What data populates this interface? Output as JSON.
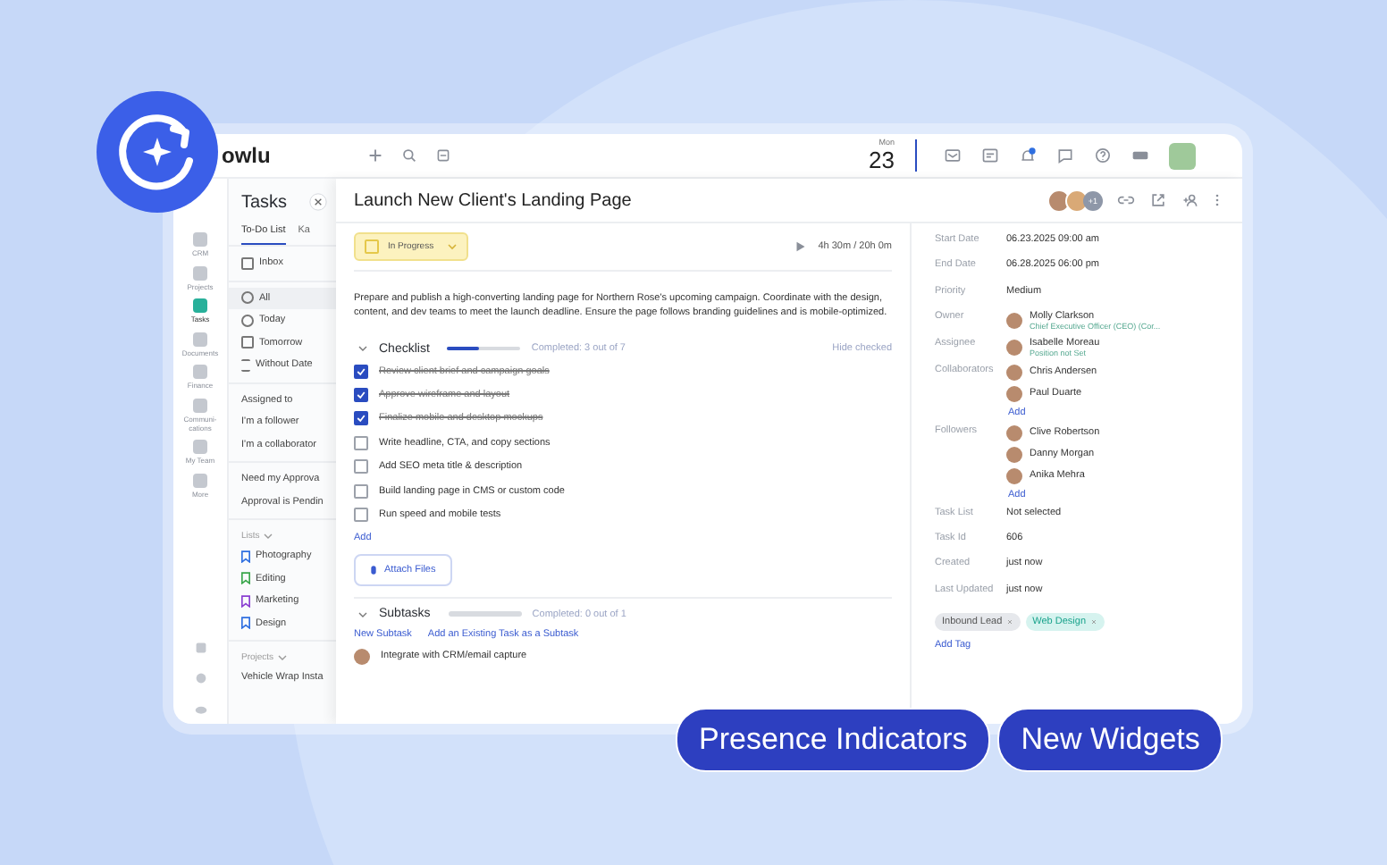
{
  "brand": {
    "text": "owlu"
  },
  "top_bar": {
    "day_name": "Mon",
    "day_number": "23"
  },
  "rail": [
    {
      "label": "CRM",
      "selected": false
    },
    {
      "label": "Projects",
      "selected": false
    },
    {
      "label": "Tasks",
      "selected": true
    },
    {
      "label": "Documents",
      "selected": false
    },
    {
      "label": "Finance",
      "selected": false
    },
    {
      "label": "Communi-cations",
      "selected": false
    },
    {
      "label": "My Team",
      "selected": false
    },
    {
      "label": "More",
      "selected": false
    }
  ],
  "tasks_panel": {
    "title": "Tasks",
    "tabs": [
      {
        "label": "To-Do List",
        "selected": true
      },
      {
        "label": "Ka",
        "selected": false
      }
    ],
    "groups": [
      [
        {
          "label": "Inbox",
          "kind": "inbox",
          "selected": false
        }
      ],
      [
        {
          "label": "All",
          "kind": "chat",
          "selected": true
        },
        {
          "label": "Today",
          "kind": "star",
          "selected": false
        },
        {
          "label": "Tomorrow",
          "kind": "calendar",
          "selected": false
        },
        {
          "label": "Without Date",
          "kind": "list",
          "selected": false
        }
      ],
      [
        {
          "label": "Assigned to",
          "kind": "text",
          "selected": false
        },
        {
          "label": "I'm a follower",
          "kind": "text",
          "selected": false
        },
        {
          "label": "I'm a collaborator",
          "kind": "text",
          "selected": false
        }
      ],
      [
        {
          "label": "Need my Approva",
          "kind": "text",
          "selected": false
        },
        {
          "label": "Approval is Pendin",
          "kind": "text",
          "selected": false
        }
      ]
    ],
    "lists": {
      "label": "Lists",
      "items": [
        {
          "label": "Photography",
          "color": "#2f6fe0"
        },
        {
          "label": "Editing",
          "color": "#3aa64b"
        },
        {
          "label": "Marketing",
          "color": "#8a3fd1"
        },
        {
          "label": "Design",
          "color": "#2f6fe0"
        }
      ]
    },
    "projects": {
      "label": "Projects",
      "items": [
        {
          "label": "Vehicle Wrap Insta"
        }
      ]
    }
  },
  "task": {
    "title": "Launch New Client's Landing Page",
    "extra_watchers": "+1",
    "status": "In Progress",
    "timer": "4h 30m / 20h 0m",
    "description": "Prepare and publish a high-converting landing page for Northern Rose's upcoming campaign. Coordinate with the design, content, and dev teams to meet the launch deadline. Ensure the page follows branding guidelines and is mobile-optimized.",
    "checklist": {
      "title": "Checklist",
      "level": 0.43,
      "summary": "Completed: 3 out of 7",
      "hide": "Hide checked",
      "add": "Add",
      "items": [
        {
          "label": "Review client brief and campaign goals",
          "checked": true
        },
        {
          "label": "Approve wireframe and layout",
          "checked": true
        },
        {
          "label": "Finalize mobile and desktop mockups",
          "checked": true
        },
        {
          "label": "Write headline, CTA, and copy sections",
          "checked": false
        },
        {
          "label": "Add SEO meta title & description",
          "checked": false
        },
        {
          "label": "Build landing page in CMS or custom code",
          "checked": false
        },
        {
          "label": "Run speed and mobile tests",
          "checked": false
        }
      ]
    },
    "attach": "Attach Files",
    "subtasks": {
      "title": "Subtasks",
      "level": 0,
      "summary": "Completed: 0 out of 1",
      "links": [
        "New Subtask",
        "Add an Existing Task as a Subtask"
      ],
      "items": [
        {
          "label": "Integrate with CRM/email capture"
        }
      ]
    }
  },
  "details": [
    {
      "label": "Start Date",
      "kind": "text",
      "value": "06.23.2025 09:00 am"
    },
    {
      "label": "End Date",
      "kind": "text",
      "value": "06.28.2025 06:00 pm"
    },
    {
      "label": "Priority",
      "kind": "text",
      "value": "Medium"
    },
    {
      "label": "Owner",
      "kind": "people",
      "people": [
        {
          "name": "Molly Clarkson",
          "subtitle": "Chief Executive Officer (CEO) (Cor..."
        }
      ]
    },
    {
      "label": "Assignee",
      "kind": "people",
      "people": [
        {
          "name": "Isabelle Moreau",
          "subtitle": "Position not Set"
        }
      ]
    },
    {
      "label": "Collaborators",
      "kind": "people",
      "people": [
        {
          "name": "Chris Andersen"
        },
        {
          "name": "Paul Duarte"
        }
      ],
      "add": "Add"
    },
    {
      "label": "Followers",
      "kind": "people",
      "people": [
        {
          "name": "Clive Robertson"
        },
        {
          "name": "Danny Morgan"
        },
        {
          "name": "Anika Mehra"
        }
      ],
      "add": "Add"
    },
    {
      "label": "Task List",
      "kind": "text",
      "value": "Not selected"
    },
    {
      "label": "Task Id",
      "kind": "text",
      "value": "606"
    },
    {
      "label": "Created",
      "kind": "text",
      "value": "just now"
    },
    {
      "label": "Last Updated",
      "kind": "text",
      "value": "just now"
    }
  ],
  "tags": [
    {
      "label": "Inbound Lead",
      "color": "#e6e8ec"
    },
    {
      "label": "Web Design",
      "color": "#d6f3ef"
    }
  ],
  "add_tag": "Add Tag",
  "pills": [
    "Presence Indicators",
    "New Widgets"
  ]
}
